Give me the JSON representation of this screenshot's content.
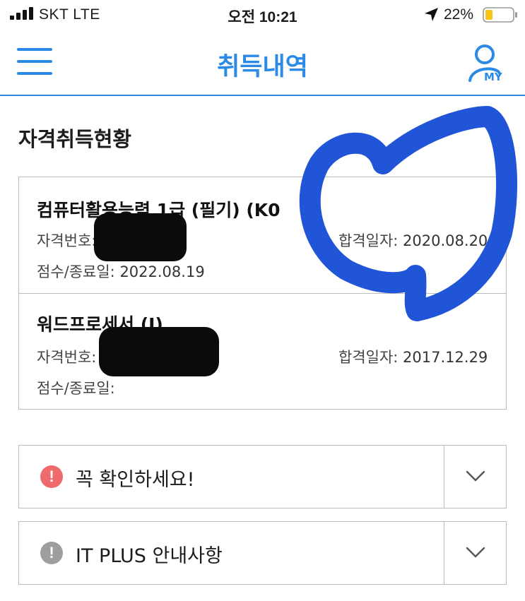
{
  "status_bar": {
    "carrier": "SKT  LTE",
    "time": "오전 10:21",
    "battery": "22%",
    "icons": [
      "signal-icon",
      "location-arrow-icon",
      "battery-icon"
    ]
  },
  "header": {
    "title": "취득내역",
    "my_label": "MY",
    "accent_color": "#2a8ae6",
    "icons": [
      "hamburger-menu-icon",
      "user-icon"
    ]
  },
  "section": {
    "title": "자격취득현황"
  },
  "certificates": [
    {
      "name": "컴퓨터활용능력 1급 (필기) (K0",
      "number_label": "자격번호:",
      "pass_label": "합격일자:",
      "pass_date": "2020.08.20",
      "score_label": "점수/종료일:",
      "score_value": "2022.08.19"
    },
    {
      "name": "워드프로세서 (I)",
      "number_label": "자격번호:",
      "pass_label": "합격일자:",
      "pass_date": "2017.12.29",
      "score_label": "점수/종료일:",
      "score_value": ""
    }
  ],
  "accordions": [
    {
      "label": "꼭 확인하세요!",
      "icon": "alert-circle-icon",
      "icon_symbol": "!",
      "icon_color": "#ef6a6a"
    },
    {
      "label": "IT PLUS 안내사항",
      "icon": "info-circle-icon",
      "icon_symbol": "!",
      "icon_color": "#9e9e9e"
    }
  ],
  "colors": {
    "scribble": "#1a4fd6",
    "redaction": "#0b0b0b",
    "border": "#bcbcbc"
  }
}
